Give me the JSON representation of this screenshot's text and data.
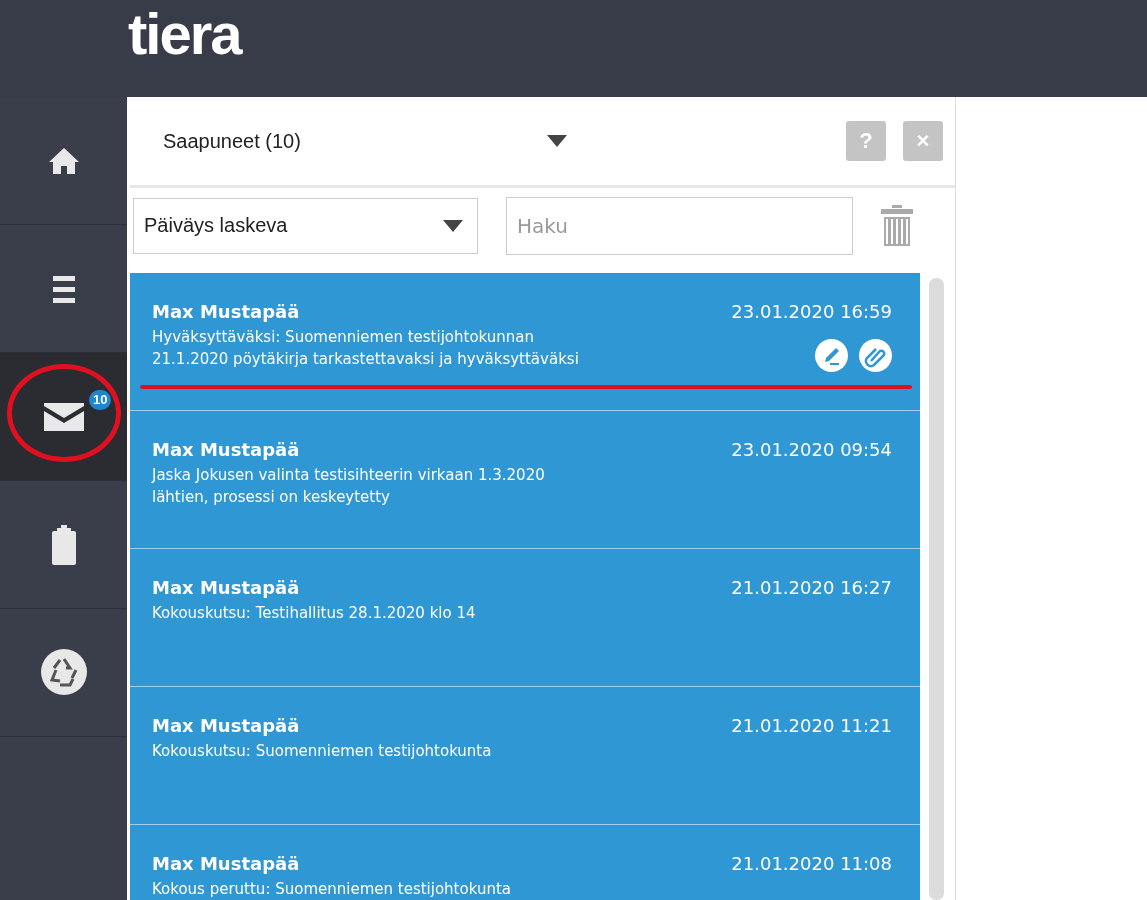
{
  "header": {
    "logo": "tiera"
  },
  "sidebar": {
    "items": [
      {
        "kind": "home",
        "selected": false
      },
      {
        "kind": "menu",
        "selected": false
      },
      {
        "kind": "mail",
        "selected": true,
        "badge": "10"
      },
      {
        "kind": "clipboard",
        "selected": false
      },
      {
        "kind": "recycle",
        "selected": false
      }
    ]
  },
  "panel": {
    "folder": "Saapuneet (10)",
    "help_button": "?",
    "close_button": "×",
    "sort": "Päiväys laskeva",
    "search": {
      "placeholder": "Haku"
    }
  },
  "messages": [
    {
      "sender": "Max Mustapää",
      "date": "23.01.2020 16:59",
      "subject_lines": [
        "Hyväksyttäväksi: Suomenniemen testijohtokunnan",
        "21.1.2020 pöytäkirja tarkastettavaksi ja hyväksyttäväksi"
      ],
      "needs_signature": true,
      "has_attachment": true
    },
    {
      "sender": "Max Mustapää",
      "date": "23.01.2020 09:54",
      "subject_lines": [
        "Jaska Jokusen valinta testisihteerin virkaan 1.3.2020",
        "lähtien, prosessi on keskeytetty"
      ],
      "needs_signature": false,
      "has_attachment": false
    },
    {
      "sender": "Max Mustapää",
      "date": "21.01.2020 16:27",
      "subject_lines": [
        "Kokouskutsu: Testihallitus 28.1.2020 klo 14"
      ],
      "needs_signature": false,
      "has_attachment": false
    },
    {
      "sender": "Max Mustapää",
      "date": "21.01.2020 11:21",
      "subject_lines": [
        "Kokouskutsu: Suomenniemen testijohtokunta"
      ],
      "needs_signature": false,
      "has_attachment": false
    },
    {
      "sender": "Max Mustapää",
      "date": "21.01.2020 11:08",
      "subject_lines": [
        "Kokous peruttu: Suomenniemen testijohtokunta"
      ],
      "needs_signature": false,
      "has_attachment": false
    }
  ]
}
